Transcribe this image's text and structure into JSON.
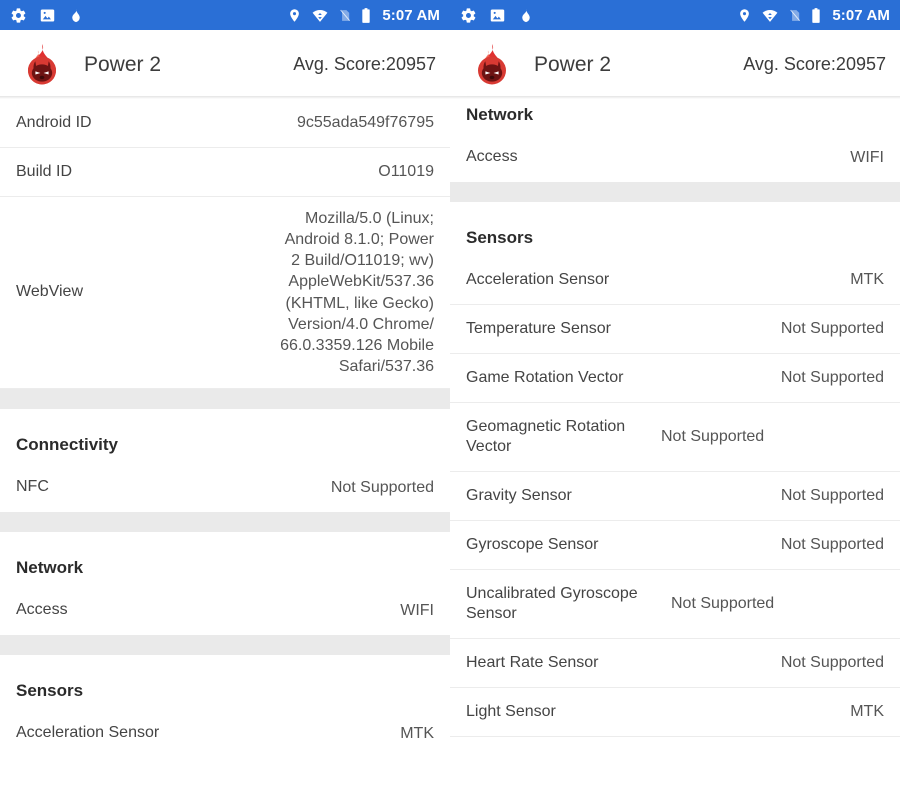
{
  "status_bar": {
    "icons_left": [
      "gear-icon",
      "photo-icon",
      "flame-icon"
    ],
    "icons_right": [
      "location-pin-icon",
      "wifi-icon",
      "sim-card-off-icon",
      "battery-icon"
    ],
    "time": "5:07 AM",
    "background_color": "#2a6fd6"
  },
  "app_bar": {
    "logo": "antutu-flame-logo",
    "title": "Power 2",
    "score": "Avg. Score:20957"
  },
  "colors": {
    "accent": "#2a6fd6",
    "section_gap": "#eaeaea",
    "divider": "#ececec",
    "label": "#444444",
    "value": "#555555",
    "heading": "#2b2b2b"
  },
  "left_panel": {
    "rows_top": [
      {
        "label": "Android ID",
        "value": "9c55ada549f76795"
      },
      {
        "label": "Build ID",
        "value": "O11019"
      },
      {
        "label": "WebView",
        "value": "Mozilla/5.0 (Linux;\nAndroid 8.1.0; Power\n2 Build/O11019; wv)\nAppleWebKit/537.36\n(KHTML, like Gecko)\nVersion/4.0 Chrome/\n66.0.3359.126 Mobile\nSafari/537.36"
      }
    ],
    "sections": [
      {
        "heading": "Connectivity",
        "rows": [
          {
            "label": "NFC",
            "value": "Not Supported"
          }
        ]
      },
      {
        "heading": "Network",
        "rows": [
          {
            "label": "Access",
            "value": "WIFI"
          }
        ]
      },
      {
        "heading": "Sensors",
        "rows": [
          {
            "label": "Acceleration Sensor",
            "value": "MTK"
          }
        ]
      }
    ]
  },
  "right_panel": {
    "sections": [
      {
        "heading": "Network",
        "rows": [
          {
            "label": "Access",
            "value": "WIFI"
          }
        ]
      },
      {
        "heading": "Sensors",
        "rows": [
          {
            "label": "Acceleration Sensor",
            "value": "MTK"
          },
          {
            "label": "Temperature Sensor",
            "value": "Not Supported"
          },
          {
            "label": "Game Rotation Vector",
            "value": "Not Supported"
          },
          {
            "label": "Geomagnetic Rotation Vector",
            "value": "Not Supported"
          },
          {
            "label": "Gravity Sensor",
            "value": "Not Supported"
          },
          {
            "label": "Gyroscope Sensor",
            "value": "Not Supported"
          },
          {
            "label": "Uncalibrated Gyroscope Sensor",
            "value": "Not Supported"
          },
          {
            "label": "Heart Rate Sensor",
            "value": "Not Supported"
          },
          {
            "label": "Light Sensor",
            "value": "MTK"
          }
        ]
      }
    ]
  }
}
